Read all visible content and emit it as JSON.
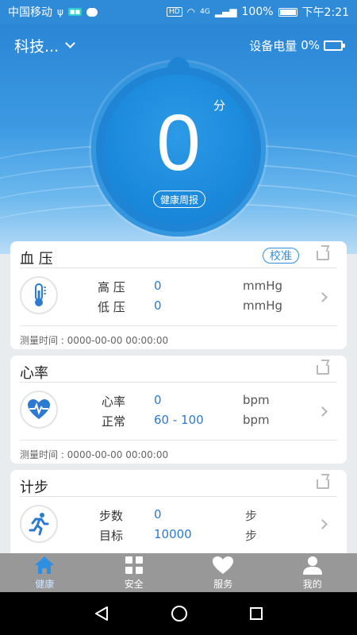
{
  "statusbar": {
    "carrier": "中国移动",
    "network": "4G",
    "battery": "100%",
    "time": "下午2:21",
    "hd": "HD"
  },
  "header": {
    "device_name": "科技...",
    "battery_label": "设备电量",
    "battery_value": "0%"
  },
  "score": {
    "value": "0",
    "unit": "分",
    "weekly_report": "健康周报"
  },
  "blood_pressure": {
    "title": "血 压",
    "calibrate": "校准",
    "rows": [
      {
        "label": "高 压",
        "value": "0",
        "unit": "mmHg"
      },
      {
        "label": "低 压",
        "value": "0",
        "unit": "mmHg"
      }
    ],
    "measure_time": "测量时间 : 0000-00-00 00:00:00"
  },
  "heart_rate": {
    "title": "心率",
    "rows": [
      {
        "label": "心率",
        "value": "0",
        "unit": "bpm"
      },
      {
        "label": "正常",
        "value": "60 - 100",
        "unit": "bpm"
      }
    ],
    "measure_time": "测量时间 : 0000-00-00 00:00:00"
  },
  "steps": {
    "title": "计步",
    "rows": [
      {
        "label": "步数",
        "value": "0",
        "unit": "步"
      },
      {
        "label": "目标",
        "value": "10000",
        "unit": "步"
      }
    ]
  },
  "nav": {
    "items": [
      {
        "label": "健康",
        "icon": "home-icon",
        "active": true
      },
      {
        "label": "安全",
        "icon": "grid-icon",
        "active": false
      },
      {
        "label": "服务",
        "icon": "heart-icon",
        "active": false
      },
      {
        "label": "我的",
        "icon": "person-icon",
        "active": false
      }
    ]
  },
  "colors": {
    "primary": "#2a86d6",
    "value_blue": "#2c7bd0",
    "nav_bg": "#989898"
  }
}
